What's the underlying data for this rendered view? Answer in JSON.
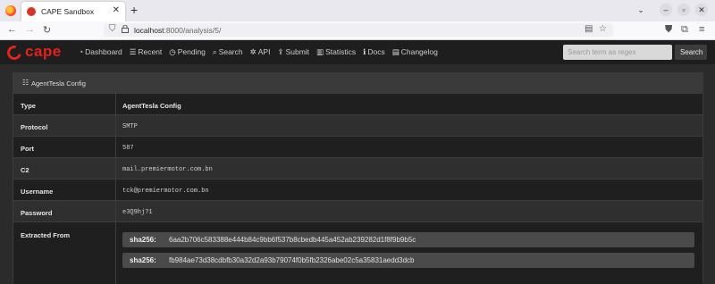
{
  "browser": {
    "tab_title": "CAPE Sandbox",
    "url_host": "localhost",
    "url_rest": ":8000/analysis/5/"
  },
  "app": {
    "brand": "cape",
    "menu": [
      {
        "icon": "dashboard-icon",
        "glyph": "◔",
        "label": "Dashboard"
      },
      {
        "icon": "list-icon",
        "glyph": "☰",
        "label": "Recent"
      },
      {
        "icon": "clock-icon",
        "glyph": "◷",
        "label": "Pending"
      },
      {
        "icon": "search-icon",
        "glyph": "⌕",
        "label": "Search"
      },
      {
        "icon": "gears-icon",
        "glyph": "✲",
        "label": "API"
      },
      {
        "icon": "upload-icon",
        "glyph": "⇪",
        "label": "Submit"
      },
      {
        "icon": "chart-icon",
        "glyph": "▥",
        "label": "Statistics"
      },
      {
        "icon": "info-icon",
        "glyph": "ℹ",
        "label": "Docs"
      },
      {
        "icon": "changelog-icon",
        "glyph": "▤",
        "label": "Changelog"
      }
    ],
    "search_placeholder": "Search term as regex",
    "search_button": "Search"
  },
  "panel": {
    "title": "AgentTesla Config",
    "rows": [
      {
        "key": "Type",
        "value": "AgentTesla Config"
      },
      {
        "key": "Protocol",
        "value": "SMTP"
      },
      {
        "key": "Port",
        "value": "587"
      },
      {
        "key": "C2",
        "value": "mail.premiermotor.com.bn"
      },
      {
        "key": "Username",
        "value": "tck@premiermotor.com.bn"
      },
      {
        "key": "Password",
        "value": "e3Q9hj?1"
      }
    ],
    "extracted_label": "Extracted From",
    "hashes": [
      {
        "label": "sha256:",
        "value": "6aa2b706c583388e444b84c9bb6f537b8cbedb445a452ab239282d1f8f9b9b5c"
      },
      {
        "label": "sha256:",
        "value": "fb984ae73d38cdbfb30a32d2a93b79074f0b5fb2326abe02c5a35831aedd3dcb"
      }
    ]
  }
}
